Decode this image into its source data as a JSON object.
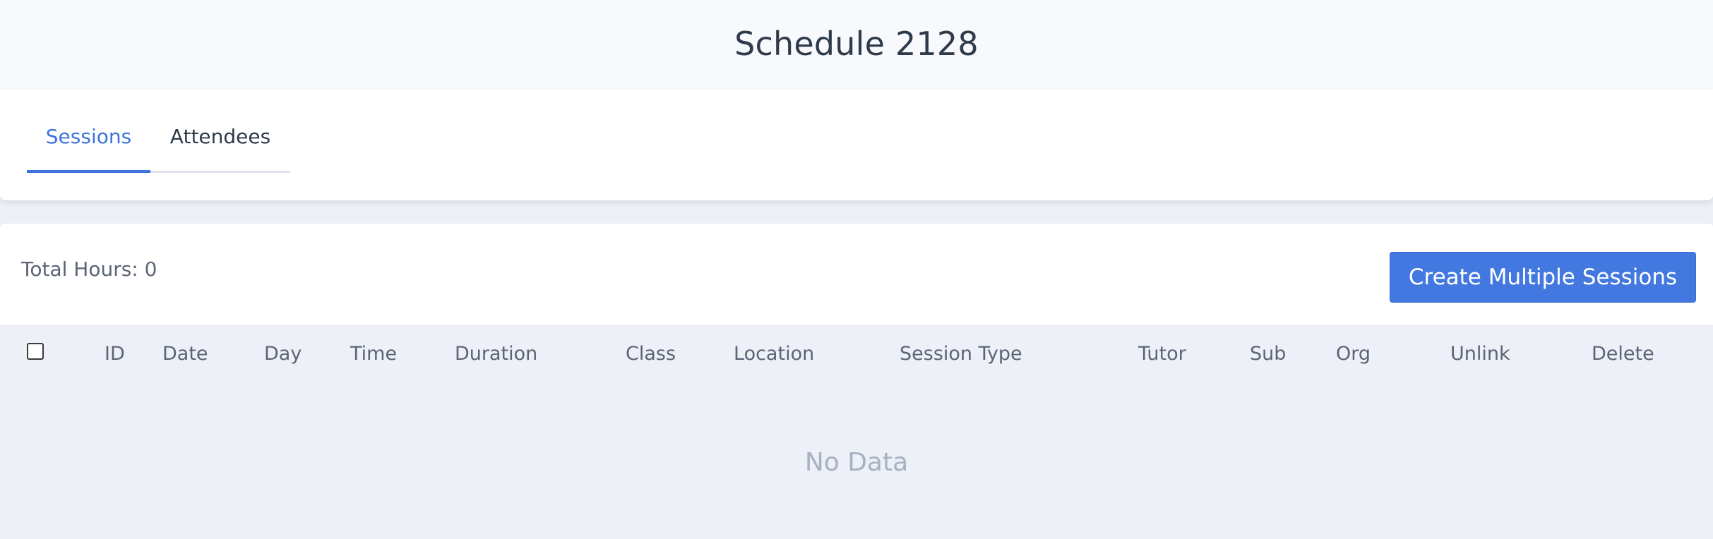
{
  "page": {
    "title": "Schedule 2128"
  },
  "tabs": [
    {
      "label": "Sessions",
      "active": true
    },
    {
      "label": "Attendees",
      "active": false
    }
  ],
  "summary": {
    "total_hours_label": "Total Hours: 0"
  },
  "toolbar": {
    "create_multiple_label": "Create Multiple Sessions"
  },
  "table": {
    "columns": [
      "ID",
      "Date",
      "Day",
      "Time",
      "Duration",
      "Class",
      "Location",
      "Session Type",
      "Tutor",
      "Sub",
      "Org",
      "Unlink",
      "Delete"
    ],
    "rows": [],
    "empty_text": "No Data"
  },
  "colors": {
    "accent": "#3c73dd",
    "button": "#4278e0",
    "background": "#edf0f7"
  }
}
